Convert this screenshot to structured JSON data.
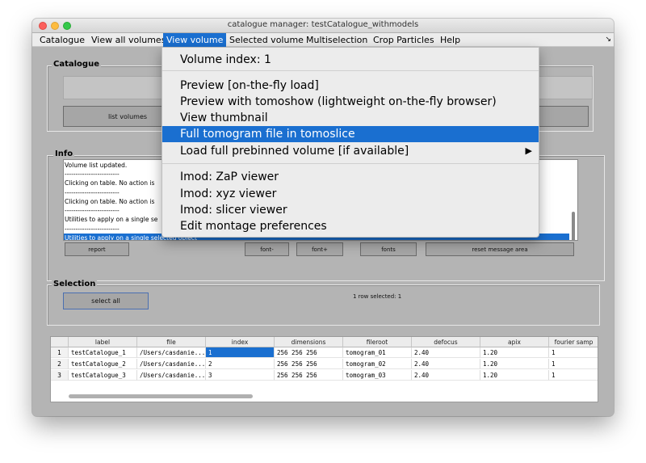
{
  "window": {
    "title": "catalogue manager: testCatalogue_withmodels"
  },
  "menubar": {
    "items": [
      "Catalogue",
      "View all volumes",
      "View volume",
      "Selected volume",
      "Multiselection",
      "Crop Particles",
      "Help"
    ],
    "overflow_icon": "chevron-down-icon"
  },
  "catalogue_panel": {
    "legend": "Catalogue",
    "list_volumes_label": "list volumes"
  },
  "info_panel": {
    "legend": "Info",
    "lines": [
      "Volume list updated.",
      "-------------------------",
      "Clicking on table. No action is",
      "-------------------------",
      "Clicking on table. No action is",
      "-------------------------",
      "Utilities to apply on a single se",
      "-------------------------",
      "Utilities to apply on a single selected object"
    ],
    "buttons": {
      "report": "report",
      "font_minus": "font-",
      "font_plus": "font+",
      "fonts": "fonts",
      "reset": "reset message area"
    }
  },
  "selection_panel": {
    "legend": "Selection",
    "select_all_label": "select all",
    "status": "1 row selected: 1"
  },
  "table": {
    "columns": [
      "label",
      "file",
      "index",
      "dimensions",
      "fileroot",
      "defocus",
      "apix",
      "fourier samp"
    ],
    "rows": [
      {
        "num": "1",
        "cells": [
          "testCatalogue_1",
          "/Users/casdanie...",
          "1",
          "256 256 256",
          "tomogram_01",
          "2.40",
          "1.20",
          "1"
        ]
      },
      {
        "num": "2",
        "cells": [
          "testCatalogue_2",
          "/Users/casdanie...",
          "2",
          "256 256 256",
          "tomogram_02",
          "2.40",
          "1.20",
          "1"
        ]
      },
      {
        "num": "3",
        "cells": [
          "testCatalogue_3",
          "/Users/casdanie...",
          "3",
          "256 256 256",
          "tomogram_03",
          "2.40",
          "1.20",
          "1"
        ]
      }
    ],
    "selected_cell": "row 1, index"
  },
  "dropdown": {
    "header": "Volume index: 1",
    "items": [
      "Preview [on-the-fly load]",
      "Preview with tomoshow (lightweight on-the-fly browser)",
      "View thumbnail",
      "Full tomogram file in tomoslice",
      "Load full prebinned volume [if available]",
      "Imod: ZaP viewer",
      "Imod: xyz viewer",
      "Imod: slicer viewer",
      "Edit montage preferences"
    ],
    "highlighted": "Full tomogram file in tomoslice",
    "submenu_icon": "triangle-right-icon"
  },
  "colors": {
    "highlight": "#1a6fd0",
    "window_bg": "#b4b4b4",
    "menubar_bg": "#ececec"
  }
}
